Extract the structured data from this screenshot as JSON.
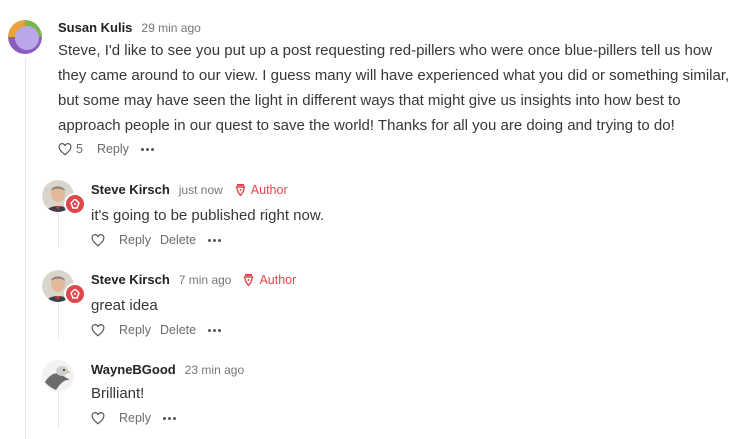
{
  "comments": [
    {
      "author": "Susan Kulis",
      "time": "29 min ago",
      "text": "Steve, I'd like to see you put up a post requesting red-pillers who were once blue-pillers tell us how they came around to our view. I guess many will have experienced what you did or something similar, but some may have seen the light in different ways that might give us insights into how best to approach people in our quest to save the world! Thanks for all you are doing and trying to do!",
      "likes": "5",
      "reply_label": "Reply"
    },
    {
      "author": "Steve Kirsch",
      "time": "just now",
      "author_badge": "Author",
      "text": "it's going to be published right now.",
      "reply_label": "Reply",
      "delete_label": "Delete"
    },
    {
      "author": "Steve Kirsch",
      "time": "7 min ago",
      "author_badge": "Author",
      "text": "great idea",
      "reply_label": "Reply",
      "delete_label": "Delete"
    },
    {
      "author": "WayneBGood",
      "time": "23 min ago",
      "text": "Brilliant!",
      "reply_label": "Reply"
    }
  ],
  "colors": {
    "accent": "#e0474c",
    "thread_line": "#e6e6e6",
    "muted": "#6b6b6b"
  },
  "icons": {
    "like": "heart-icon",
    "author": "pen-nib-icon",
    "more": "ellipsis-icon"
  }
}
